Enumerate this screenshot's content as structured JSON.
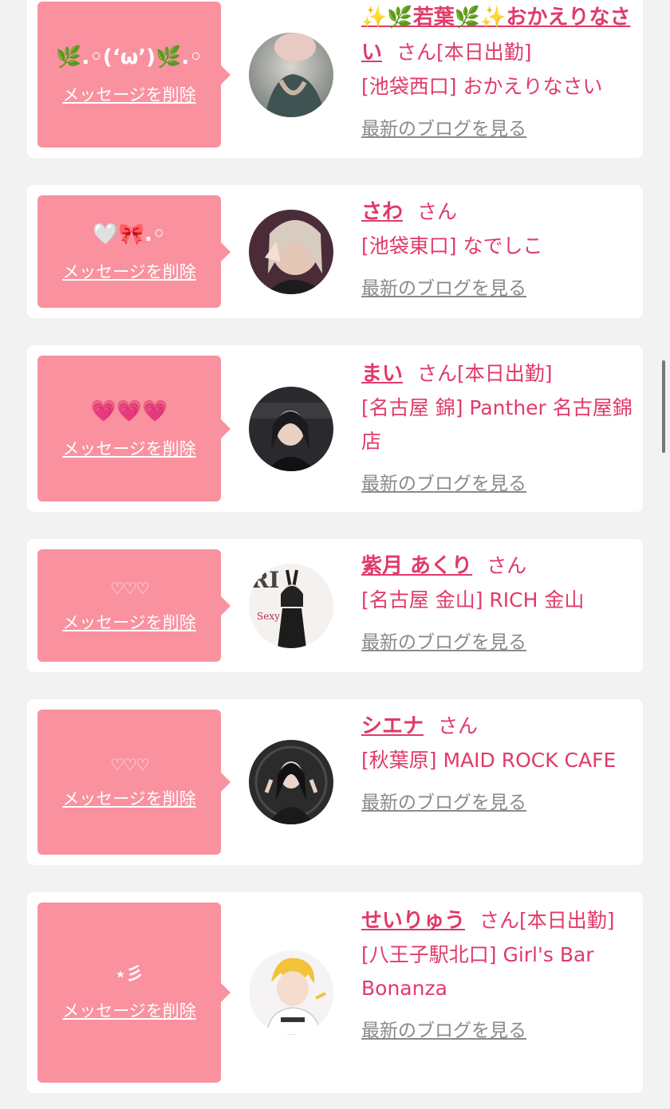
{
  "delete_label": "メッセージを削除",
  "blog_label": "最新のブログを見る",
  "colors": {
    "accent": "#e03a6a",
    "bubble": "#f9919f",
    "link_gray": "#8a8a8a",
    "bg": "#f2f2f2"
  },
  "items": [
    {
      "message": "🌿.◦(ʻωʼ)🌿.◦",
      "name": "✨🌿若葉🌿✨おかえりなさい",
      "honorific": "さん",
      "status": "[本日出勤]",
      "shop": "[池袋西口] おかえりなさい",
      "avatar_icon": "woman-photo-icon"
    },
    {
      "message": "🤍🎀.◦",
      "name": "さわ",
      "honorific": "さん",
      "status": "",
      "shop": "[池袋東口] なでしこ",
      "avatar_icon": "woman-photo-icon"
    },
    {
      "message": "💗💗💗",
      "name": "まい",
      "honorific": "さん",
      "status": "[本日出勤]",
      "shop": "[名古屋 錦] Panther 名古屋錦店",
      "avatar_icon": "woman-photo-icon"
    },
    {
      "message": "♡♡♡",
      "name": "紫月 あくり",
      "honorific": "さん",
      "status": "",
      "shop": "[名古屋 金山] RICH 金山",
      "avatar_icon": "magazine-photo-icon"
    },
    {
      "message": "♡♡♡",
      "name": "シエナ",
      "honorific": "さん",
      "status": "",
      "shop": "[秋葉原] MAID ROCK CAFE",
      "avatar_icon": "woman-photo-icon"
    },
    {
      "message": "⋆彡",
      "name": "せいりゅう",
      "honorific": "さん",
      "status": "[本日出勤]",
      "shop": "[八王子駅北口] Girl's Bar Bonanza",
      "avatar_icon": "anime-illustration-icon"
    }
  ]
}
